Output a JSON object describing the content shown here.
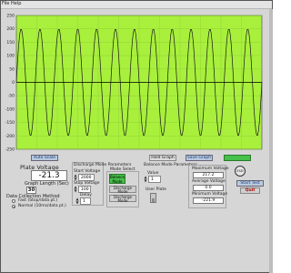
{
  "menu": {
    "items": [
      "File",
      "Help"
    ]
  },
  "chart": {
    "y_ticks": [
      "250",
      "200",
      "150",
      "100",
      "50",
      "0",
      "-50",
      "-100",
      "-150",
      "-200",
      "-250"
    ],
    "plot_bg": "#a8f03c",
    "trace_color": "#1a1a1a",
    "axis_line_color": "#000000"
  },
  "chart_data": {
    "type": "line",
    "title": "",
    "ylabel": "",
    "xlabel": "",
    "ylim": [
      -250,
      250
    ],
    "grid": true,
    "series": [
      {
        "samples_per_cycle": 22,
        "cycles": 13,
        "amplitude": 200,
        "offset": 0
      }
    ]
  },
  "buttons": {
    "auto_scale": "Auto Scale",
    "hold_graph": "Hold Graph",
    "save_graph": "Save Graph",
    "start_test": "Start Test",
    "quit": "Quit"
  },
  "plate_voltage": {
    "label": "Plate Voltage",
    "value": "-21.3"
  },
  "graph_length": {
    "label": "Graph Length (Sec)",
    "value": "30"
  },
  "data_collection": {
    "label": "Data Collection Method",
    "options": [
      "Fast (Stop/data pt.)",
      "Normal (10ms/data pt.)"
    ]
  },
  "discharge": {
    "title": "Discharge Mode Parameters",
    "start_voltage_label": "Start Voltage",
    "start_voltage": "2000",
    "stop_voltage_label": "Stop Voltage",
    "stop_voltage": "100",
    "delay_label": "Delay",
    "delay": "1"
  },
  "mode": {
    "title": "Mode Select",
    "options": [
      "Balance Mode",
      "Discharge Mode",
      "Discharge Mode"
    ]
  },
  "balance": {
    "title": "Balance Mode Parameters",
    "value_label": "Value",
    "value": "1",
    "user_plate_label": "User Plate"
  },
  "stats": {
    "max_label": "Maximum Voltage",
    "max_value": "217.2",
    "avg_label": "Average Voltage",
    "avg_value": "0.0",
    "min_label": "Minimum Voltage",
    "min_value": "-221.9"
  },
  "logo": {
    "text": "ESD"
  }
}
